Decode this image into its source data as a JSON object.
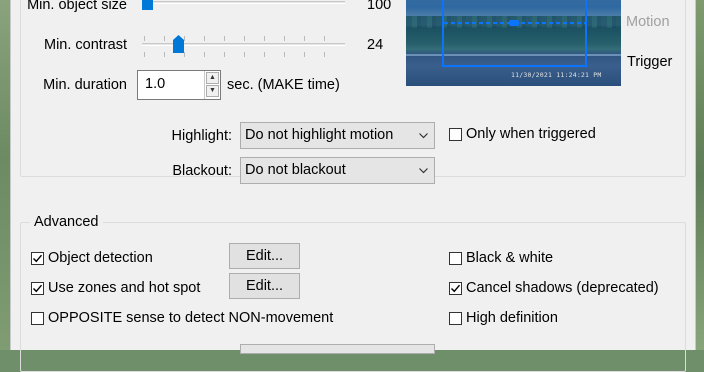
{
  "detection": {
    "min_object_size": {
      "label": "Min. object size",
      "value": "100",
      "level": 0.02
    },
    "min_contrast": {
      "label": "Min. contrast",
      "value": "24",
      "level": 0.19
    },
    "min_duration": {
      "label": "Min. duration",
      "value": "1.0",
      "unit": "sec.  (MAKE time)"
    }
  },
  "preview": {
    "timestamp": "11/30/2021 11:24:21 PM",
    "motion_label": "Motion",
    "trigger_label": "Trigger"
  },
  "display": {
    "highlight": {
      "label": "Highlight:",
      "selected": "Do not highlight motion"
    },
    "only_when_triggered": {
      "label": "Only when triggered",
      "checked": false
    },
    "blackout": {
      "label": "Blackout:",
      "selected": "Do not blackout"
    }
  },
  "advanced": {
    "title": "Advanced",
    "object_detection": {
      "label": "Object detection",
      "checked": true
    },
    "object_detection_edit": "Edit...",
    "zones": {
      "label": "Use zones and hot spot",
      "checked": true
    },
    "zones_edit": "Edit...",
    "opposite": {
      "label": "OPPOSITE sense to detect NON-movement",
      "checked": false
    },
    "black_white": {
      "label": "Black & white",
      "checked": false
    },
    "cancel_shadows": {
      "label": "Cancel shadows (deprecated)",
      "checked": true
    },
    "high_definition": {
      "label": "High definition",
      "checked": false
    }
  },
  "colors": {
    "accent": "#0078d7",
    "motion_label": "#a0a0a0"
  }
}
